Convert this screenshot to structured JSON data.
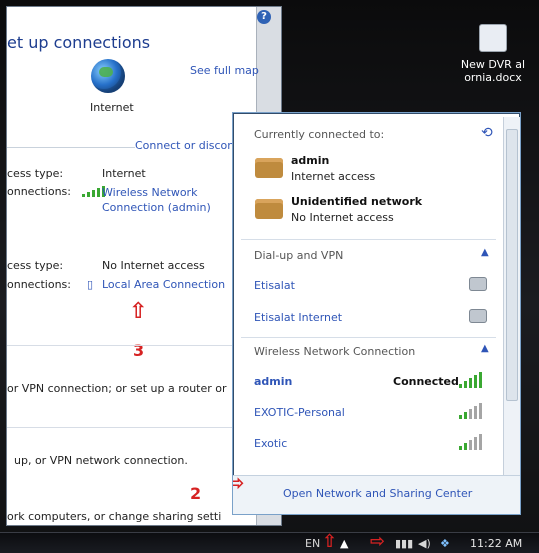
{
  "left_window": {
    "title": "et up connections",
    "see_full_map": "See full map",
    "internet_label": "Internet",
    "connect_or_disconnect": "Connect or disconn",
    "access_type_1_label": "cess type:",
    "access_type_1_value": "Internet",
    "connections_1_label": "onnections:",
    "connections_1_value": "Wireless Network\nConnection (admin)",
    "access_type_2_label": "cess type:",
    "access_type_2_value": "No Internet access",
    "connections_2_label": "onnections:",
    "connections_2_value": "Local Area Connection",
    "vpn_text_1": "or VPN connection; or set up a router or",
    "vpn_text_2": "up, or VPN network connection.",
    "bottom_text": "ork computers, or change sharing setti"
  },
  "annotations": {
    "n2": "2",
    "n3": "3"
  },
  "popup": {
    "currently_connected_to": "Currently connected to:",
    "conn1_name": "admin",
    "conn1_status": "Internet access",
    "conn2_name": "Unidentified network",
    "conn2_status": "No Internet access",
    "section_dialup": "Dial-up and VPN",
    "dialup_item_1": "Etisalat",
    "dialup_item_2": "Etisalat Internet",
    "section_wireless": "Wireless Network Connection",
    "wifi_1": "admin",
    "wifi_1_status": "Connected",
    "wifi_2": "EXOTIC-Personal",
    "wifi_3": "Exotic",
    "footer_link": "Open Network and Sharing Center"
  },
  "desktop_icon": {
    "label_line1": "New DVR al",
    "label_line2": "ornia.docx"
  },
  "taskbar": {
    "lang": "EN",
    "time": "11:22 AM"
  },
  "colors": {
    "link_blue": "#2f55b7",
    "annotation_red": "#d62222",
    "signal_green": "#3aa832"
  }
}
